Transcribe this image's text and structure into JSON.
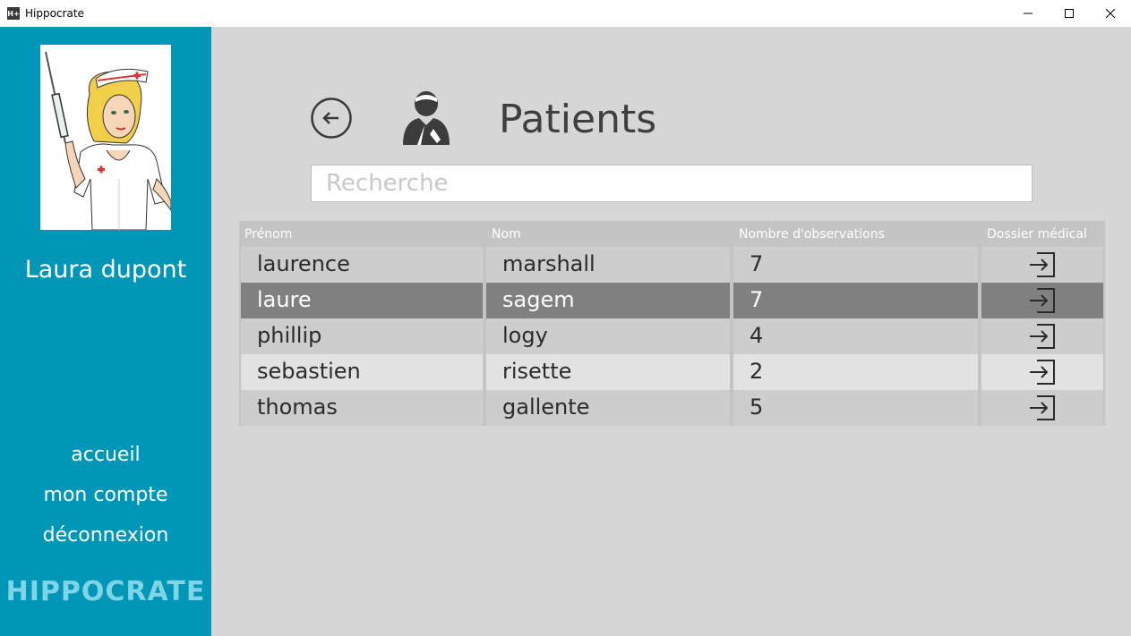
{
  "window": {
    "title": "Hippocrate",
    "app_icon_text": "H+",
    "controls": [
      "minimize-icon",
      "maximize-icon",
      "close-icon"
    ]
  },
  "sidebar": {
    "user_name": "Laura dupont",
    "nav": [
      {
        "label": "accueil"
      },
      {
        "label": "mon compte"
      },
      {
        "label": "déconnexion"
      }
    ],
    "brand": "HIPPOCRATE",
    "color": "#0096b7"
  },
  "main": {
    "title": "Patients",
    "search": {
      "placeholder": "Recherche",
      "value": ""
    },
    "back_icon": "back-arrow-icon",
    "title_icon": "patient-icon"
  },
  "table": {
    "columns": [
      "Prénom",
      "Nom",
      "Nombre d'observations",
      "Dossier médical"
    ],
    "rows": [
      {
        "prenom": "laurence",
        "nom": "marshall",
        "observations": "7"
      },
      {
        "prenom": "laure",
        "nom": "sagem",
        "observations": "7",
        "selected": true
      },
      {
        "prenom": "phillip",
        "nom": "logy",
        "observations": "4"
      },
      {
        "prenom": "sebastien",
        "nom": "risette",
        "observations": "2"
      },
      {
        "prenom": "thomas",
        "nom": "gallente",
        "observations": "5"
      }
    ],
    "open_icon": "open-folder-icon"
  }
}
